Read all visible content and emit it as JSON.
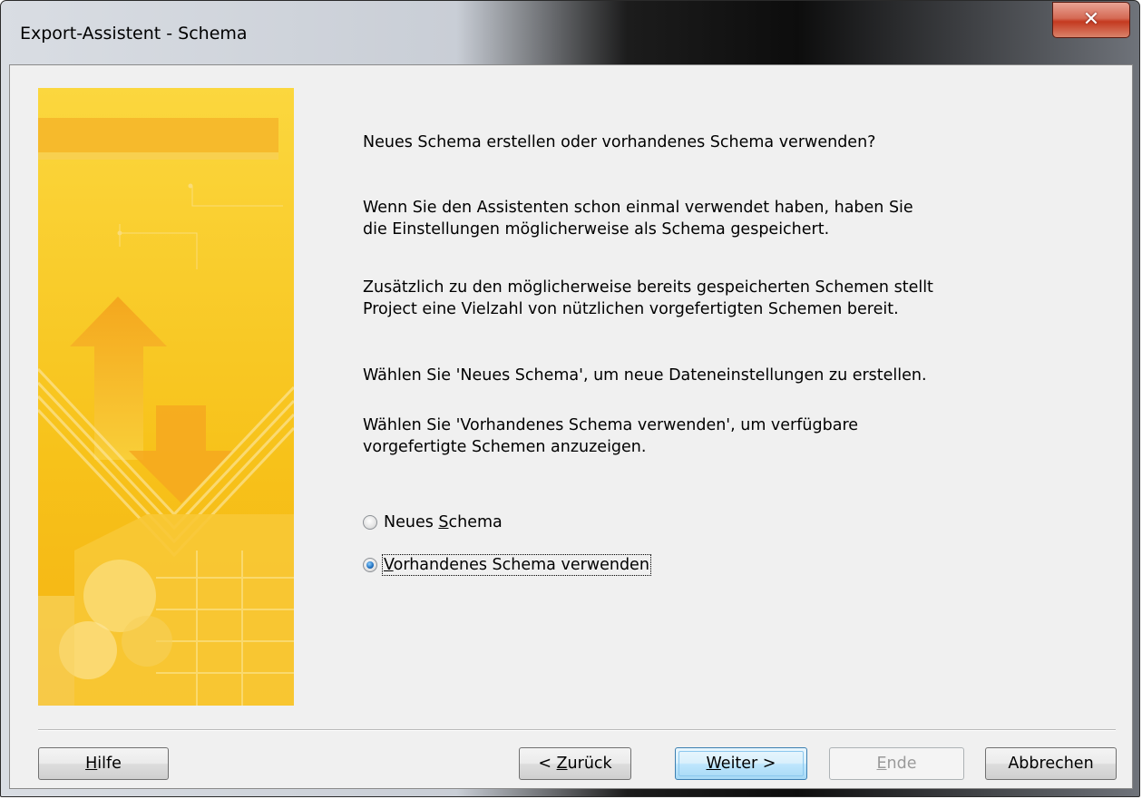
{
  "window": {
    "title": "Export-Assistent - Schema",
    "close_icon": "close-icon"
  },
  "content": {
    "question": "Neues Schema erstellen oder vorhandenes Schema verwenden?",
    "para1": "Wenn Sie den Assistenten schon einmal verwendet haben, haben Sie\ndie Einstellungen möglicherweise als Schema gespeichert.",
    "para2": "Zusätzlich zu den möglicherweise bereits gespeicherten Schemen stellt\nProject eine Vielzahl von nützlichen vorgefertigten Schemen bereit.",
    "para3": "Wählen Sie 'Neues Schema', um neue Dateneinstellungen zu erstellen.",
    "para4": "Wählen Sie 'Vorhandenes Schema verwenden', um verfügbare\nvorgefertigte Schemen anzuzeigen."
  },
  "options": [
    {
      "label_pre": "Neues ",
      "label_mnemonic": "S",
      "label_post": "chema",
      "selected": false
    },
    {
      "label_pre": "",
      "label_mnemonic": "V",
      "label_post": "orhandenes Schema verwenden",
      "selected": true
    }
  ],
  "buttons": {
    "help": {
      "mnemonic": "H",
      "rest": "ilfe"
    },
    "back": {
      "pre": "< ",
      "mnemonic": "Z",
      "rest": "urück"
    },
    "next": {
      "mnemonic": "W",
      "rest": "eiter >"
    },
    "finish": {
      "mnemonic": "E",
      "rest": "nde",
      "enabled": false
    },
    "cancel": {
      "label": "Abbrechen"
    }
  },
  "colors": {
    "banner_primary": "#f7c21a",
    "banner_accent": "#f29f1c",
    "default_button": "#3c7fb1"
  }
}
